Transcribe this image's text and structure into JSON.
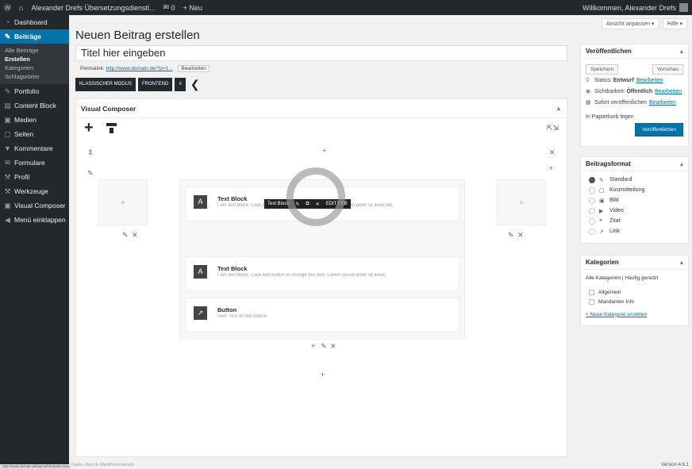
{
  "adminbar": {
    "wp_logo": "Ⓦ",
    "home_icon": "⌂",
    "site_name": "Alexander Drefs Übersetzungsdienstl...",
    "comments_count": "0",
    "new_label": "+ Neu",
    "greeting": "Willkommen, Alexander Drefs"
  },
  "sidebar": {
    "items": [
      {
        "icon": "◔",
        "label": "Dashboard"
      },
      {
        "icon": "✎",
        "label": "Beiträge"
      },
      {
        "icon": "✎",
        "label": "Portfolio"
      },
      {
        "icon": "▤",
        "label": "Content Block"
      },
      {
        "icon": "▣",
        "label": "Medien"
      },
      {
        "icon": "▢",
        "label": "Seiten"
      },
      {
        "icon": "▼",
        "label": "Kommentare"
      },
      {
        "icon": "✉",
        "label": "Formulare"
      },
      {
        "icon": "⚒",
        "label": "Profil"
      },
      {
        "icon": "⚒",
        "label": "Werkzeuge"
      },
      {
        "icon": "▣",
        "label": "Visual Composer"
      },
      {
        "icon": "◀",
        "label": "Menü einklappen"
      }
    ],
    "submenu": [
      "Alle Beiträge",
      "Erstellen",
      "Kategorien",
      "Schlagwörter"
    ]
  },
  "screen": {
    "options": "Ansicht anpassen ▾",
    "help": "Hilfe ▾"
  },
  "page_title": "Neuen Beitrag erstellen",
  "title_value": "Titel hier eingeben",
  "permalink": {
    "label": "Permalink:",
    "url": "http://www.domain.de/?p=1...",
    "edit": "Bearbeiten"
  },
  "editor_buttons": {
    "classic": "KLASSISCHER MODUS",
    "frontend": "FRONTEND",
    "more": "≡"
  },
  "vc": {
    "heading": "Visual Composer",
    "add_icon": "+",
    "controls": {
      "move": "⇕",
      "pencil": "✎",
      "trash": "✕",
      "plus": "+"
    },
    "elements": [
      {
        "icon": "A",
        "title": "Text Block",
        "desc": "I am text block. Click edit button to change this text. Lorem ipsum dolor sit amet elit."
      },
      {
        "icon": "A",
        "title": "Text Block",
        "desc": "I am text block. Click edit button to change this text. Lorem ipsum dolor sit amet."
      },
      {
        "icon": "↗",
        "title": "Button",
        "desc": "Text: Text on the button"
      }
    ],
    "el_controls": {
      "name": "Text Block",
      "edit": "✎",
      "clone": "⧉",
      "delete": "✕",
      "settings": "EDIT FEB"
    }
  },
  "publish": {
    "heading": "Veröffentlichen",
    "save_draft": "Speichern",
    "preview": "Vorschau",
    "status_label": "Status:",
    "status_value": "Entwurf",
    "status_edit": "Bearbeiten",
    "visibility_label": "Sichtbarkeit:",
    "visibility_value": "Öffentlich",
    "visibility_edit": "Bearbeiten",
    "schedule_label": "Sofort veröffentlichen",
    "schedule_edit": "Bearbeiten",
    "trash": "In Papierkorb legen",
    "publish": "Veröffentlichen"
  },
  "format": {
    "heading": "Beitragsformat",
    "options": [
      {
        "icon": "✎",
        "label": "Standard",
        "checked": true
      },
      {
        "icon": "▢",
        "label": "Kurzmitteilung",
        "checked": false
      },
      {
        "icon": "▣",
        "label": "Bild",
        "checked": false
      },
      {
        "icon": "▶",
        "label": "Video",
        "checked": false
      },
      {
        "icon": "❝",
        "label": "Zitat",
        "checked": false
      },
      {
        "icon": "↗",
        "label": "Link",
        "checked": false
      }
    ]
  },
  "categories": {
    "heading": "Kategorien",
    "tab_all": "Alle Kategorien",
    "tab_popular": "Häufig genutzt",
    "items": [
      "Allgemein",
      "Mandanten Info"
    ],
    "add_new": "+ Neue Kategorie erstellen"
  },
  "footer": {
    "left": "Danke, dass du WordPress benutzt.",
    "version": "Version 4.6.1",
    "status_url": "http://www.domain.de/wp-admin/post-new.php"
  }
}
